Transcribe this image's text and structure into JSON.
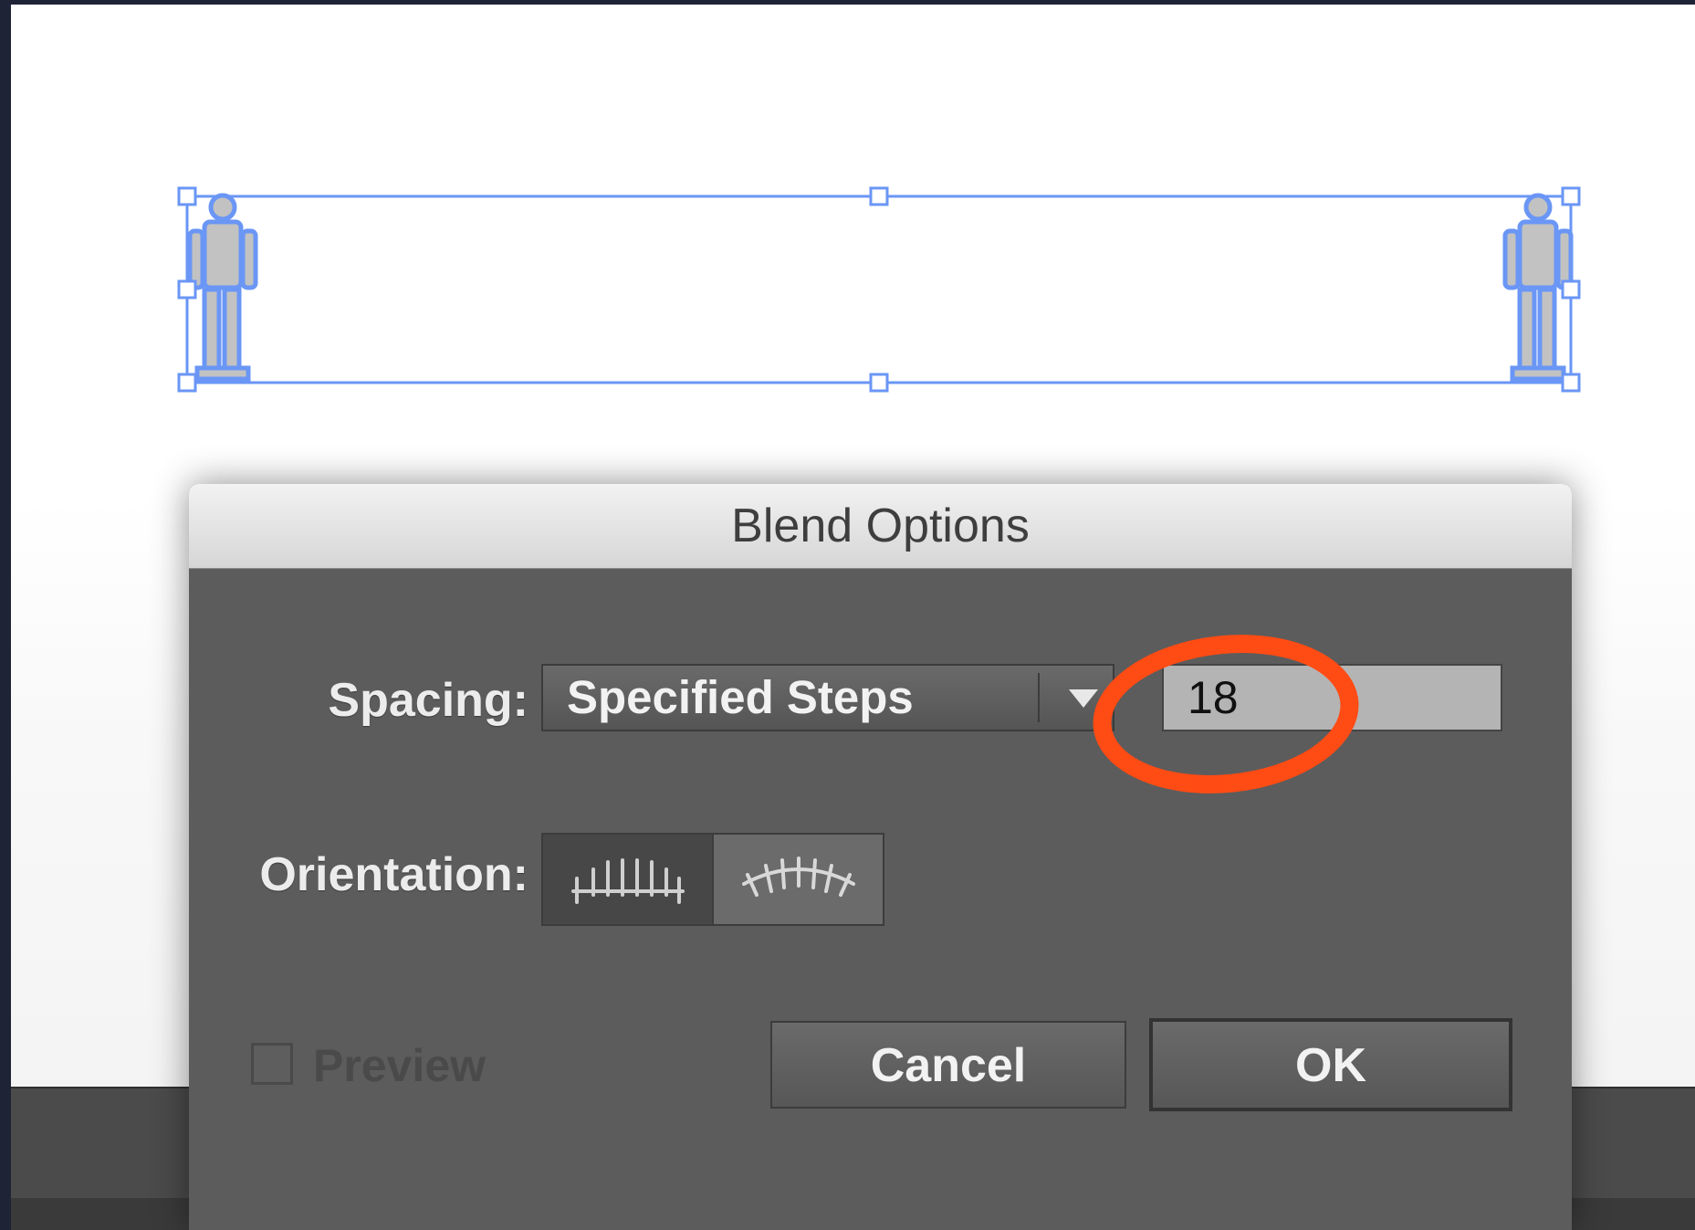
{
  "dialog": {
    "title": "Blend Options",
    "spacing": {
      "label": "Spacing:",
      "mode": "Specified Steps",
      "steps_value": "18"
    },
    "orientation": {
      "label": "Orientation:",
      "options": [
        "align-to-page",
        "align-to-path"
      ],
      "selected": "align-to-page"
    },
    "preview": {
      "label": "Preview",
      "checked": false,
      "enabled": false
    },
    "cancel_label": "Cancel",
    "ok_label": "OK"
  },
  "colors": {
    "selection_blue": "#6a96f5",
    "highlight_ring": "#ff4b14",
    "dialog_bg": "#5c5c5c"
  },
  "icons": [
    "align-to-page-icon",
    "align-to-path-icon",
    "chevron-down-icon"
  ]
}
